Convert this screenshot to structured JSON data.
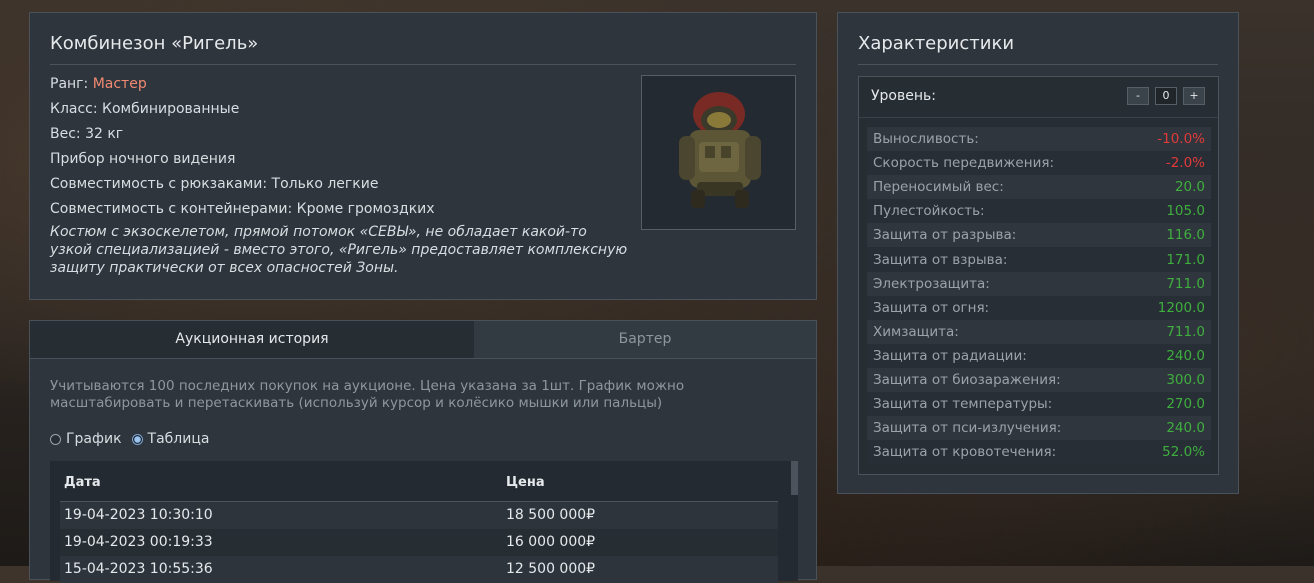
{
  "item": {
    "title": "Комбинезон «Ригель»",
    "rank_label": "Ранг: ",
    "rank_value": "Мастер",
    "class": "Класс: Комбинированные",
    "weight": "Вес: 32 кг",
    "night_vision": "Прибор ночного видения",
    "backpacks": "Совместимость с рюкзаками: Только легкие",
    "containers": "Совместимость с контейнерами: Кроме громоздких",
    "description": "Костюм с экзоскелетом, прямой потомок «СЕВЫ», не обладает какой-то узкой специализацией - вместо этого, «Ригель» предоставляет комплексную защиту практически от всех опасностей Зоны."
  },
  "history": {
    "tabs": [
      "Аукционная история",
      "Бартер"
    ],
    "hint": "Учитываются 100 последних покупок на аукционе. Цена указана за 1шт. График можно масштабировать и перетаскивать (используй курсор и колёсико мышки или пальцы)",
    "radio_graph": "График",
    "radio_table": "Таблица",
    "columns": [
      "Дата",
      "Цена"
    ],
    "rows": [
      [
        "19-04-2023 10:30:10",
        "18 500 000₽"
      ],
      [
        "19-04-2023 00:19:33",
        "16 000 000₽"
      ],
      [
        "15-04-2023 10:55:36",
        "12 500 000₽"
      ]
    ]
  },
  "stats": {
    "title": "Характеристики",
    "level_label": "Уровень:",
    "level_minus": "-",
    "level_value": "0",
    "level_plus": "+",
    "items": [
      {
        "name": "Выносливость:",
        "value": "-10.0%",
        "color": "#e03a3a"
      },
      {
        "name": "Скорость передвижения:",
        "value": "-2.0%",
        "color": "#e03a3a"
      },
      {
        "name": "Переносимый вес:",
        "value": "20.0",
        "color": "#3fae3f"
      },
      {
        "name": "Пулестойкость:",
        "value": "105.0",
        "color": "#3fae3f"
      },
      {
        "name": "Защита от разрыва:",
        "value": "116.0",
        "color": "#3fae3f"
      },
      {
        "name": "Защита от взрыва:",
        "value": "171.0",
        "color": "#3fae3f"
      },
      {
        "name": "Электрозащита:",
        "value": "711.0",
        "color": "#3fae3f"
      },
      {
        "name": "Защита от огня:",
        "value": "1200.0",
        "color": "#3fae3f"
      },
      {
        "name": "Химзащита:",
        "value": "711.0",
        "color": "#3fae3f"
      },
      {
        "name": "Защита от радиации:",
        "value": "240.0",
        "color": "#3fae3f"
      },
      {
        "name": "Защита от биозаражения:",
        "value": "300.0",
        "color": "#3fae3f"
      },
      {
        "name": "Защита от температуры:",
        "value": "270.0",
        "color": "#3fae3f"
      },
      {
        "name": "Защита от пси-излучения:",
        "value": "240.0",
        "color": "#3fae3f"
      },
      {
        "name": "Защита от кровотечения:",
        "value": "52.0%",
        "color": "#3fae3f"
      }
    ]
  }
}
